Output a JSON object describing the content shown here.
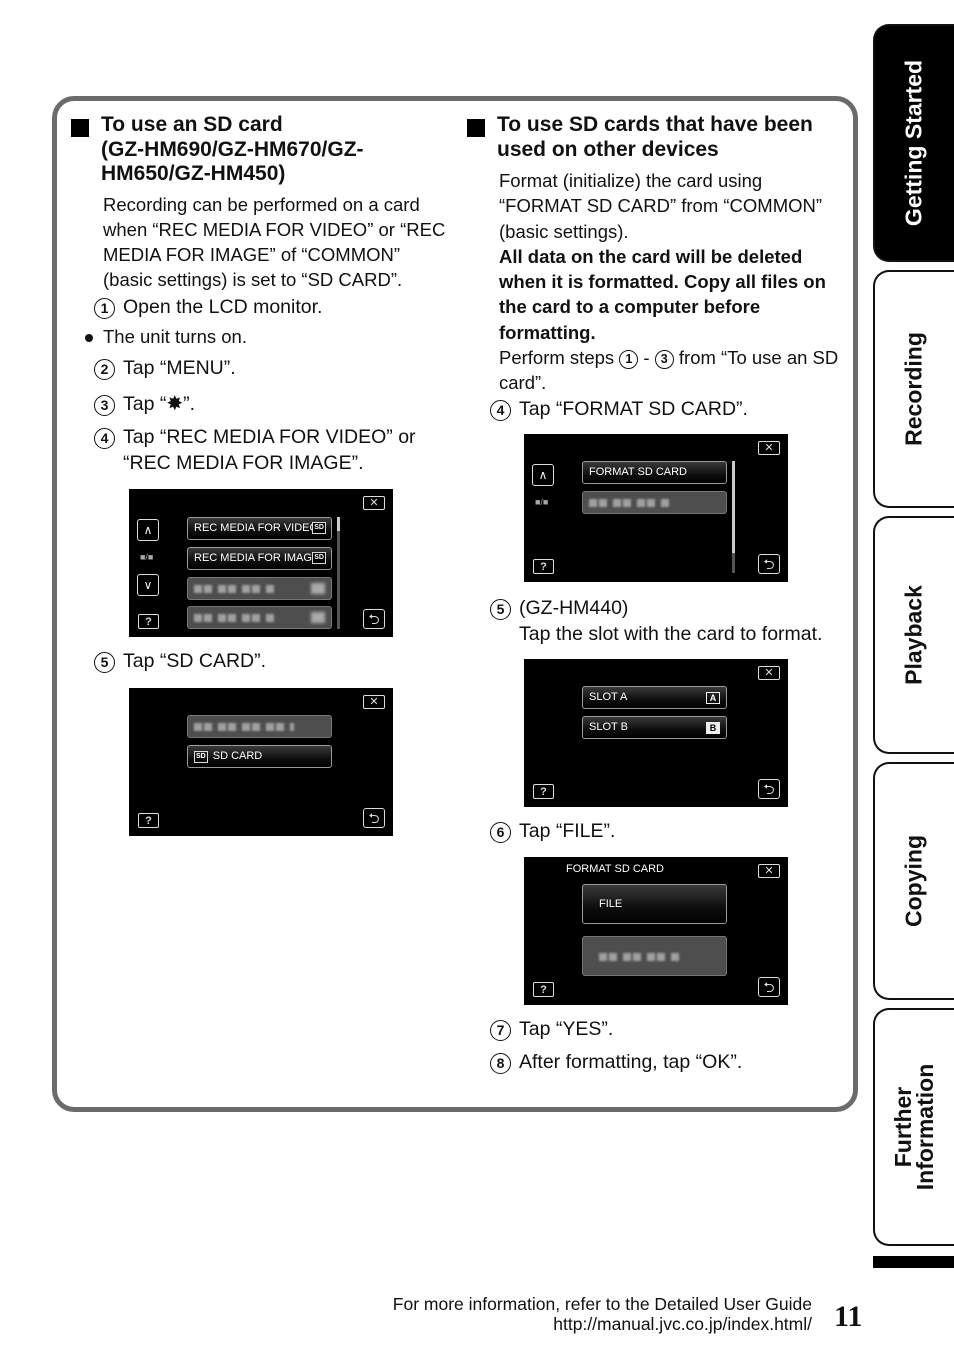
{
  "left_section": {
    "heading": "To use an SD card (GZ-HM690/GZ-HM670/GZ-HM650/GZ-HM450)",
    "heading_lines": [
      "To use an SD card",
      "(GZ-HM690/GZ-HM670/GZ-",
      "HM650/GZ-HM450)"
    ],
    "intro": "Recording can be performed on a card when “REC MEDIA FOR VIDEO” or “REC MEDIA FOR IMAGE” of “COMMON” (basic settings) is set to “SD CARD”.",
    "steps": [
      {
        "num": "1",
        "text": "Open the LCD monitor."
      },
      {
        "num": "2",
        "text": "Tap “MENU”."
      },
      {
        "num": "3",
        "text_before": "Tap “",
        "icon": "gear-icon",
        "icon_glyph": "✸",
        "text_after": "”."
      },
      {
        "num": "4",
        "text": "Tap “REC MEDIA FOR VIDEO” or “REC MEDIA FOR IMAGE”."
      },
      {
        "num": "5",
        "text": "Tap “SD CARD”."
      }
    ],
    "bullet": "The unit turns on.",
    "screen1": {
      "items": [
        "REC MEDIA FOR VIDEO",
        "REC MEDIA FOR IMAGE"
      ],
      "sd_tag": "SD",
      "pager": "■/■",
      "help": "?",
      "close": "✕",
      "back": "⮌",
      "up": "∧",
      "down": "∨"
    },
    "screen2": {
      "items": [
        "SD CARD"
      ],
      "sd_tag": "SD",
      "help": "?",
      "close": "✕",
      "back": "⮌"
    }
  },
  "right_section": {
    "heading_lines": [
      "To use SD cards that have been",
      "used on other devices"
    ],
    "intro": "Format (initialize) the card using “FORMAT SD CARD” from “COMMON” (basic settings).",
    "warning": "All data on the card will be deleted when it is formatted. Copy all files on the card to a computer before formatting.",
    "perform": {
      "before": "Perform steps ",
      "from": "1",
      "sep": " - ",
      "to": "3",
      "after": " from “To use an SD card”."
    },
    "steps": [
      {
        "num": "4",
        "text": "Tap “FORMAT SD CARD”."
      },
      {
        "num": "5",
        "text_line1": "(GZ-HM440)",
        "text_line2": "Tap the slot with the card to format."
      },
      {
        "num": "6",
        "text": "Tap “FILE”."
      },
      {
        "num": "7",
        "text": "Tap “YES”."
      },
      {
        "num": "8",
        "text": "After formatting, tap “OK”."
      }
    ],
    "screen3": {
      "items": [
        "FORMAT SD CARD"
      ],
      "pager": "■/■",
      "up": "∧",
      "help": "?",
      "close": "✕",
      "back": "⮌"
    },
    "screen4": {
      "items": [
        "SLOT A",
        "SLOT B"
      ],
      "badges": [
        "A",
        "B"
      ],
      "help": "?",
      "close": "✕",
      "back": "⮌"
    },
    "screen5": {
      "title": "FORMAT SD CARD",
      "items": [
        "FILE"
      ],
      "help": "?",
      "close": "✕",
      "back": "⮌"
    }
  },
  "side_tabs": [
    {
      "label": "Getting Started",
      "active": true
    },
    {
      "label": "Recording",
      "active": false
    },
    {
      "label": "Playback",
      "active": false
    },
    {
      "label": "Copying",
      "active": false
    },
    {
      "label": "Further Information",
      "label_lines": [
        "Further",
        "Information"
      ],
      "active": false
    }
  ],
  "footer": {
    "line1": "For more information, refer to the Detailed User Guide",
    "line2": "http://manual.jvc.co.jp/index.html/",
    "page_number": "11"
  }
}
